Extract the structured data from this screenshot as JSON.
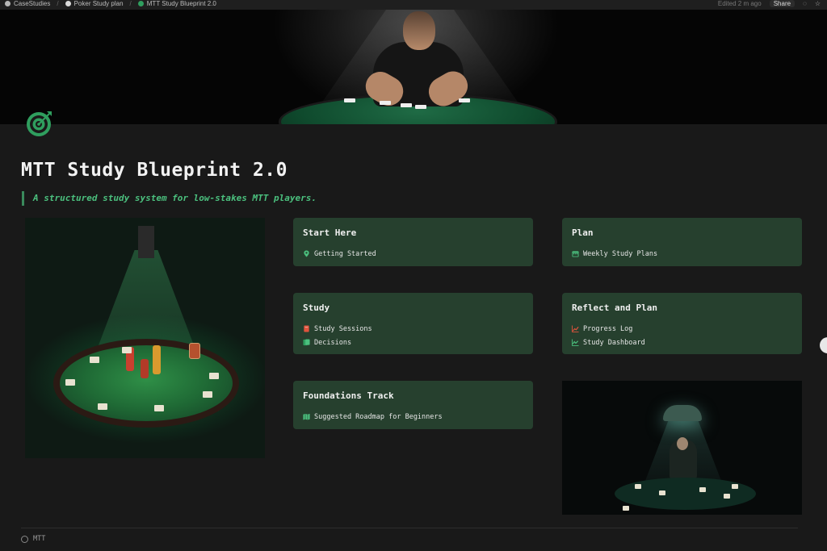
{
  "topbar": {
    "breadcrumbs": [
      {
        "label": "CaseStudies",
        "icon_color": "#b7b7b7"
      },
      {
        "label": "Poker Study plan",
        "icon_color": "#d9d9d9"
      },
      {
        "label": "MTT Study Blueprint 2.0",
        "icon_color": "#2f9e5e"
      }
    ],
    "edited": "Edited 2 m ago",
    "share_label": "Share"
  },
  "page": {
    "icon": "target-icon",
    "title": "MTT Study Blueprint 2.0",
    "subtitle": "A structured study system for low-stakes MTT players."
  },
  "cards": {
    "start_here": {
      "title": "Start Here",
      "links": [
        {
          "label": "Getting Started",
          "icon": "location-pin-icon",
          "color": "#4bc07e"
        }
      ]
    },
    "plan": {
      "title": "Plan",
      "links": [
        {
          "label": "Weekly Study Plans",
          "icon": "calendar-icon",
          "color": "#4bc07e"
        }
      ]
    },
    "study": {
      "title": "Study",
      "links": [
        {
          "label": "Study Sessions",
          "icon": "notebook-icon",
          "color": "#e0533d"
        },
        {
          "label": "Decisions",
          "icon": "cards-icon",
          "color": "#4bc07e"
        }
      ]
    },
    "reflect": {
      "title": "Reflect and Plan",
      "links": [
        {
          "label": "Progress Log",
          "icon": "trend-chart-icon",
          "color": "#e0533d"
        },
        {
          "label": "Study Dashboard",
          "icon": "dashboard-icon",
          "color": "#4bc07e"
        }
      ]
    },
    "foundations": {
      "title": "Foundations Track",
      "links": [
        {
          "label": "Suggested Roadmap for Beginners",
          "icon": "map-icon",
          "color": "#4bc07e"
        }
      ]
    }
  },
  "footer": {
    "label": "MTT"
  },
  "colors": {
    "card_bg": "#26402e",
    "accent": "#4bc07e",
    "page_bg": "#191919"
  }
}
